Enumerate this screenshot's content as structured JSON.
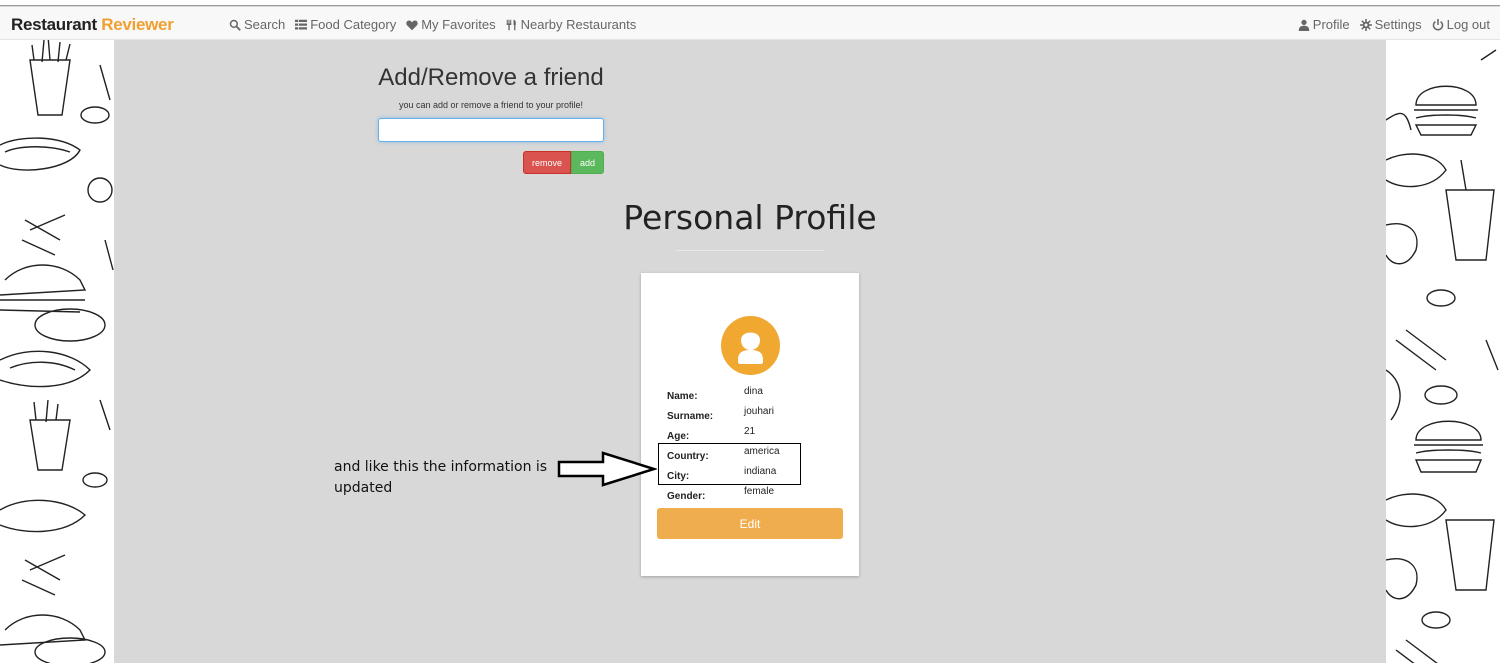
{
  "app": {
    "brand_primary": "Restaurant",
    "brand_accent": "Reviewer",
    "accent_color": "#f0a030"
  },
  "nav": {
    "left": [
      {
        "label": "Search",
        "icon": "search-icon"
      },
      {
        "label": "Food Category",
        "icon": "list-icon"
      },
      {
        "label": "My Favorites",
        "icon": "heart-icon"
      },
      {
        "label": "Nearby Restaurants",
        "icon": "cutlery-icon"
      }
    ],
    "right": [
      {
        "label": "Profile",
        "icon": "user-icon"
      },
      {
        "label": "Settings",
        "icon": "gear-icon"
      },
      {
        "label": "Log out",
        "icon": "power-icon"
      }
    ]
  },
  "friend": {
    "title": "Add/Remove a friend",
    "subtitle": "you can add or remove a friend to your profile!",
    "input_value": "",
    "remove_label": "remove",
    "add_label": "add"
  },
  "profile": {
    "title": "Personal Profile",
    "fields": [
      {
        "label": "Name:",
        "value": "dina"
      },
      {
        "label": "Surname:",
        "value": "jouhari"
      },
      {
        "label": "Age:",
        "value": "21"
      },
      {
        "label": "Country:",
        "value": "america"
      },
      {
        "label": "City:",
        "value": "indiana"
      },
      {
        "label": "Gender:",
        "value": "female"
      }
    ],
    "edit_label": "Edit"
  },
  "annotation": {
    "text": "and like this the information is updated"
  },
  "colors": {
    "remove": "#d9534f",
    "add": "#5cb85c",
    "edit": "#f0ad4e",
    "avatar": "#f0a830",
    "background": "#d8d8d8"
  }
}
